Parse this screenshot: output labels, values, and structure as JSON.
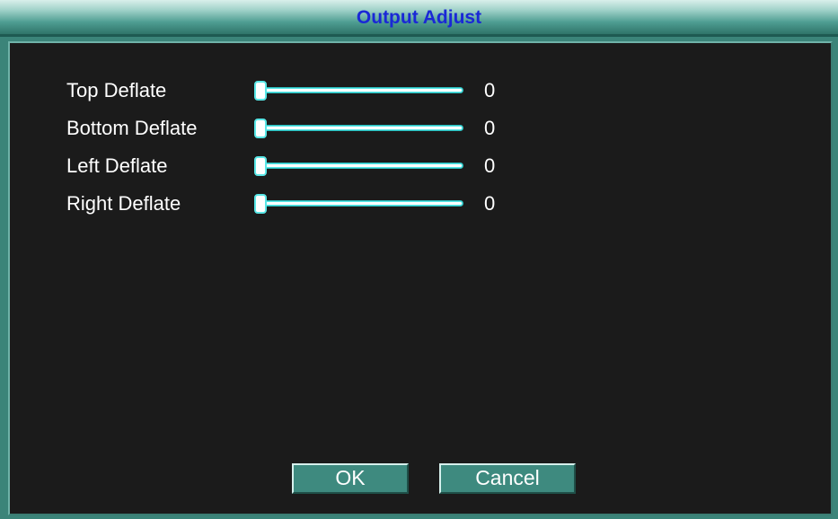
{
  "window": {
    "title": "Output Adjust"
  },
  "colors": {
    "title_text": "#1a28d6",
    "frame": "#3b8479",
    "panel": "#1b1b1b",
    "slider_accent": "#59e7e7",
    "button_face": "#3e8a7f"
  },
  "settings": [
    {
      "label": "Top Deflate",
      "value": "0",
      "level": 0
    },
    {
      "label": "Bottom Deflate",
      "value": "0",
      "level": 0
    },
    {
      "label": "Left Deflate",
      "value": "0",
      "level": 0
    },
    {
      "label": "Right Deflate",
      "value": "0",
      "level": 0
    }
  ],
  "buttons": {
    "ok_label": "OK",
    "cancel_label": "Cancel"
  }
}
